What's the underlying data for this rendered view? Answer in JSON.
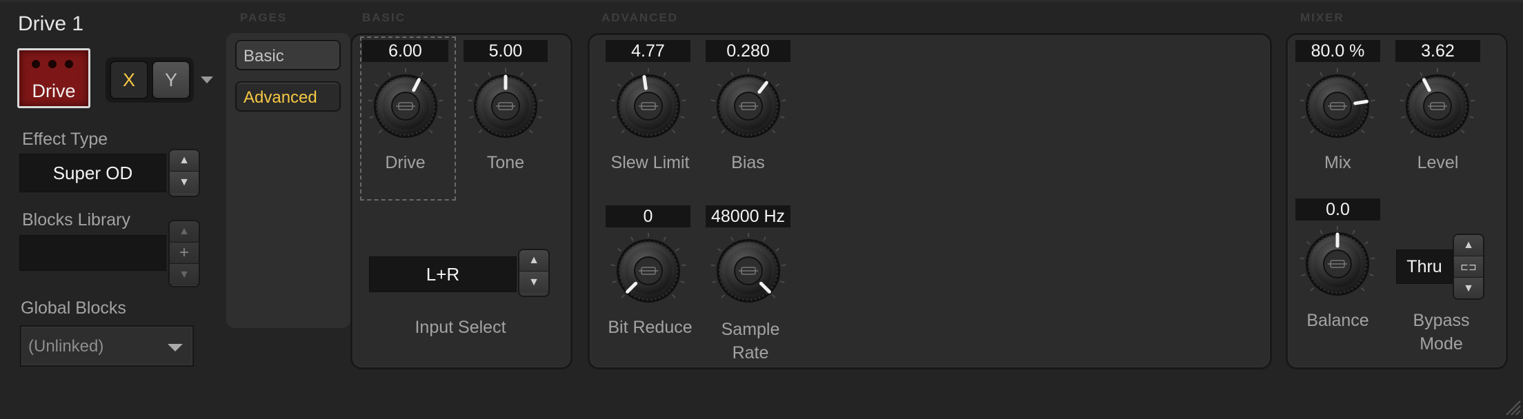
{
  "block": {
    "title": "Drive 1",
    "icon_label": "Drive",
    "icon_color": "#8a1a1a",
    "xy_x": "X",
    "xy_y": "Y",
    "accent": "#f5c844"
  },
  "left": {
    "effect_type_label": "Effect Type",
    "effect_type_value": "Super OD",
    "blocks_library_label": "Blocks Library",
    "blocks_library_value": "",
    "global_blocks_label": "Global Blocks",
    "global_blocks_value": "(Unlinked)"
  },
  "pages": {
    "header": "PAGES",
    "items": [
      {
        "label": "Basic",
        "active": false
      },
      {
        "label": "Advanced",
        "active": true
      }
    ]
  },
  "basic": {
    "header": "BASIC",
    "knobs": [
      {
        "label": "Drive",
        "value": "6.00",
        "fraction": 0.6
      },
      {
        "label": "Tone",
        "value": "5.00",
        "fraction": 0.5
      }
    ],
    "input_select_label": "Input Select",
    "input_select_value": "L+R"
  },
  "advanced": {
    "header": "ADVANCED",
    "knobs": [
      {
        "label": "Slew Limit",
        "value": "4.77",
        "fraction": 0.47
      },
      {
        "label": "Bias",
        "value": "0.280",
        "fraction": 0.64
      },
      {
        "label": "Bit Reduce",
        "value": "0",
        "fraction": 0.0
      },
      {
        "label": "Sample Rate",
        "value": "48000 Hz",
        "fraction": 1.0
      }
    ]
  },
  "mixer": {
    "header": "MIXER",
    "knobs": [
      {
        "label": "Mix",
        "value": "80.0 %",
        "fraction": 0.8
      },
      {
        "label": "Level",
        "value": "3.62",
        "fraction": 0.4
      },
      {
        "label": "Balance",
        "value": "0.0",
        "fraction": 0.5
      }
    ],
    "bypass_label_1": "Bypass",
    "bypass_label_2": "Mode",
    "bypass_value": "Thru"
  }
}
